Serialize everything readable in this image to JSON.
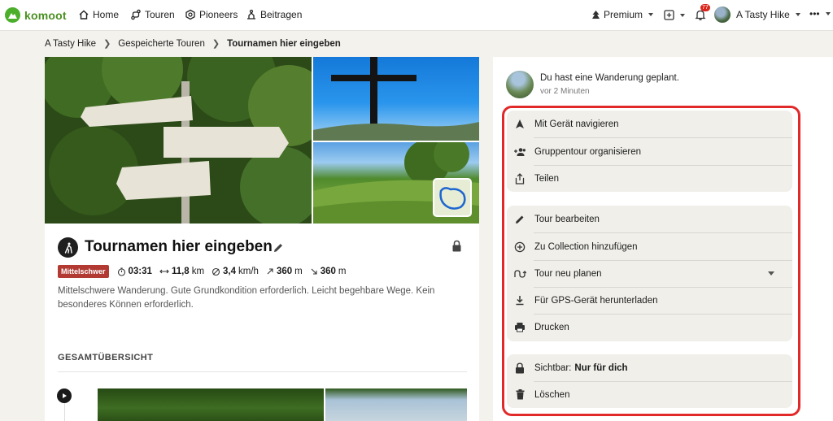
{
  "nav": {
    "brand": "komoot",
    "links": [
      {
        "label": "Home",
        "icon": "home-icon"
      },
      {
        "label": "Touren",
        "icon": "route-icon"
      },
      {
        "label": "Pioneers",
        "icon": "pioneer-icon"
      },
      {
        "label": "Beitragen",
        "icon": "contribute-icon"
      }
    ],
    "premium": "Premium",
    "notification_count": "77",
    "user_name": "A Tasty Hike",
    "more": "•••"
  },
  "breadcrumb": [
    "A Tasty Hike",
    "Gespeicherte Touren",
    "Tournamen hier eingeben"
  ],
  "tour": {
    "title": "Tournamen hier eingeben",
    "difficulty": "Mittelschwer",
    "duration": "03:31",
    "distance_value": "11,8",
    "distance_unit": "km",
    "speed_value": "3,4",
    "speed_unit": "km/h",
    "ascent_value": "360",
    "ascent_unit": "m",
    "descent_value": "360",
    "descent_unit": "m",
    "description": "Mittelschwere Wanderung. Gute Grundkondition erforderlich. Leicht begehbare Wege. Kein besonderes Können erforderlich.",
    "overview_heading": "GESAMTÜBERSICHT"
  },
  "activity": {
    "text": "Du hast eine Wanderung geplant.",
    "time": "vor 2 Minuten"
  },
  "actions": {
    "navigate": "Mit Gerät navigieren",
    "group_tour": "Gruppentour organisieren",
    "share": "Teilen",
    "edit": "Tour bearbeiten",
    "collection": "Zu Collection hinzufügen",
    "replan": "Tour neu planen",
    "gps_download": "Für GPS-Gerät herunterladen",
    "print": "Drucken",
    "visibility_label": "Sichtbar:",
    "visibility_value": "Nur für dich",
    "delete": "Löschen"
  },
  "colors": {
    "brand_green": "#4caf2b",
    "difficulty_badge": "#b23a33",
    "highlight_border": "#e2292a",
    "notification": "#d9251b"
  }
}
